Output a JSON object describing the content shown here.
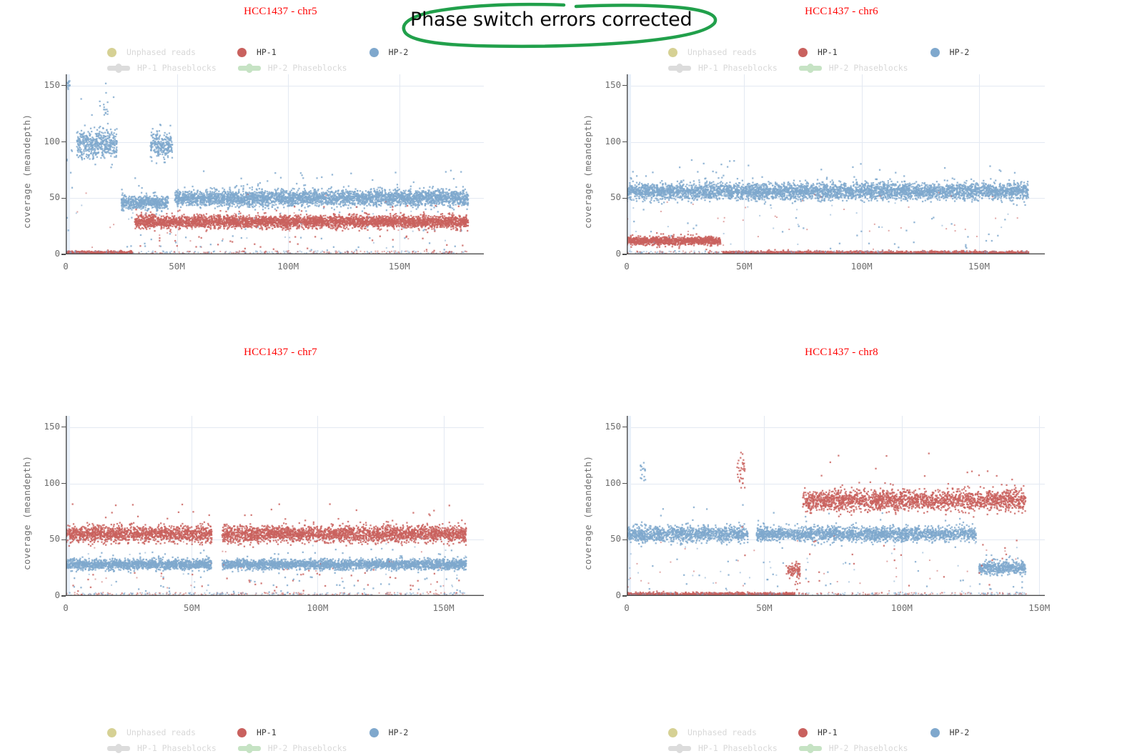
{
  "annotation": {
    "text": "Phase switch errors corrected",
    "stroke_color": "#21a04b",
    "shape": "hand-drawn-ellipse"
  },
  "colors": {
    "hp1": "#c9615e",
    "hp2": "#7fa8cd",
    "unphased": "#d6d194",
    "hp1_phaseblock": "#dcdcdc",
    "hp2_phaseblock": "#c6e3c4",
    "title": "#ff0000",
    "axis": "#4d4d4d",
    "grid": "#e3e9f2",
    "tick_text": "#6e6e6e",
    "legend_strong": "#3a3a3a",
    "legend_faint": "#d8d8d8",
    "chrom_band": "#e8f0fa"
  },
  "legend": {
    "unphased_reads": "Unphased reads",
    "hp1": "HP-1",
    "hp2": "HP-2",
    "hp1_phaseblocks": "HP-1 Phaseblocks",
    "hp2_phaseblocks": "HP-2 Phaseblocks"
  },
  "axis": {
    "ylabel": "coverage (meandepth)",
    "yticks": [
      "0",
      "50",
      "100",
      "150"
    ],
    "ytick_values": [
      0,
      50,
      100,
      150
    ],
    "ylim": [
      0,
      160
    ]
  },
  "panels": [
    {
      "id": "chr5",
      "title": "HCC1437 - chr5",
      "xticks": [
        "0",
        "50M",
        "100M",
        "150M"
      ],
      "xtick_values": [
        0,
        50,
        100,
        150
      ],
      "xlim": [
        0,
        188
      ]
    },
    {
      "id": "chr6",
      "title": "HCC1437 - chr6",
      "xticks": [
        "0",
        "50M",
        "100M",
        "150M"
      ],
      "xtick_values": [
        0,
        50,
        100,
        150
      ],
      "xlim": [
        0,
        178
      ]
    },
    {
      "id": "chr7",
      "title": "HCC1437 - chr7",
      "xticks": [
        "0",
        "50M",
        "100M",
        "150M"
      ],
      "xtick_values": [
        0,
        50,
        100,
        150
      ],
      "xlim": [
        0,
        166
      ]
    },
    {
      "id": "chr8",
      "title": "HCC1437 - chr8",
      "xticks": [
        "0",
        "50M",
        "100M",
        "150M"
      ],
      "xtick_values": [
        0,
        50,
        100,
        150
      ],
      "xlim": [
        0,
        152
      ]
    }
  ],
  "chart_data": [
    {
      "type": "scatter",
      "id": "chr5",
      "title": "HCC1437 - chr5",
      "xlabel": "",
      "ylabel": "coverage (meandepth)",
      "xlim": [
        0,
        188
      ],
      "ylim": [
        0,
        160
      ],
      "xtick_labels": [
        "0",
        "50M",
        "100M",
        "150M"
      ],
      "ytick_labels": [
        "0",
        "50",
        "100",
        "150"
      ],
      "grid": true,
      "legend": [
        "Unphased reads",
        "HP-1",
        "HP-2",
        "HP-1 Phaseblocks",
        "HP-2 Phaseblocks"
      ],
      "series": [
        {
          "name": "HP-2",
          "color": "#7fa8cd",
          "segments": [
            {
              "x_start": 0,
              "x_end": 2,
              "level": 150,
              "spread": 4,
              "density": 0.3,
              "note": "clipped top edge"
            },
            {
              "x_start": 0,
              "x_end": 3,
              "level": 75,
              "spread": 60,
              "density": 0.1,
              "note": "telomere scatter"
            },
            {
              "x_start": 5,
              "x_end": 23,
              "level": 98,
              "spread": 14,
              "density": 1.0
            },
            {
              "x_start": 17,
              "x_end": 19,
              "level": 130,
              "spread": 22,
              "density": 0.25
            },
            {
              "x_start": 25,
              "x_end": 46,
              "level": 46,
              "spread": 7,
              "density": 1.0
            },
            {
              "x_start": 38,
              "x_end": 48,
              "level": 97,
              "spread": 13,
              "density": 0.95
            },
            {
              "x_start": 49,
              "x_end": 181,
              "level": 50,
              "spread": 8,
              "density": 1.0
            }
          ]
        },
        {
          "name": "HP-1",
          "color": "#c9615e",
          "segments": [
            {
              "x_start": 0,
              "x_end": 30,
              "level": 1,
              "spread": 2,
              "density": 0.95
            },
            {
              "x_start": 31,
              "x_end": 181,
              "level": 29,
              "spread": 6,
              "density": 1.0
            }
          ]
        }
      ]
    },
    {
      "type": "scatter",
      "id": "chr6",
      "title": "HCC1437 - chr6",
      "xlabel": "",
      "ylabel": "coverage (meandepth)",
      "xlim": [
        0,
        178
      ],
      "ylim": [
        0,
        160
      ],
      "xtick_labels": [
        "0",
        "50M",
        "100M",
        "150M"
      ],
      "ytick_labels": [
        "0",
        "50",
        "100",
        "150"
      ],
      "grid": true,
      "legend": [
        "Unphased reads",
        "HP-1",
        "HP-2",
        "HP-1 Phaseblocks",
        "HP-2 Phaseblocks"
      ],
      "series": [
        {
          "name": "HP-2",
          "color": "#7fa8cd",
          "segments": [
            {
              "x_start": 0,
              "x_end": 171,
              "level": 56,
              "spread": 8,
              "density": 1.0
            }
          ]
        },
        {
          "name": "HP-1",
          "color": "#c9615e",
          "segments": [
            {
              "x_start": 0,
              "x_end": 40,
              "level": 12,
              "spread": 4,
              "density": 1.0
            },
            {
              "x_start": 41,
              "x_end": 171,
              "level": 1,
              "spread": 2,
              "density": 0.8
            }
          ]
        }
      ]
    },
    {
      "type": "scatter",
      "id": "chr7",
      "title": "HCC1437 - chr7",
      "xlabel": "",
      "ylabel": "coverage (meandepth)",
      "xlim": [
        0,
        166
      ],
      "ylim": [
        0,
        160
      ],
      "xtick_labels": [
        "0",
        "50M",
        "100M",
        "150M"
      ],
      "ytick_labels": [
        "0",
        "50",
        "100",
        "150"
      ],
      "grid": true,
      "legend": [
        "Unphased reads",
        "HP-1",
        "HP-2",
        "HP-1 Phaseblocks",
        "HP-2 Phaseblocks"
      ],
      "series": [
        {
          "name": "HP-1",
          "color": "#c9615e",
          "segments": [
            {
              "x_start": 0,
              "x_end": 58,
              "level": 55,
              "spread": 8,
              "density": 1.0
            },
            {
              "x_start": 62,
              "x_end": 159,
              "level": 55,
              "spread": 8,
              "density": 1.0
            }
          ]
        },
        {
          "name": "HP-2",
          "color": "#7fa8cd",
          "segments": [
            {
              "x_start": 0,
              "x_end": 58,
              "level": 28,
              "spread": 5,
              "density": 1.0
            },
            {
              "x_start": 62,
              "x_end": 159,
              "level": 28,
              "spread": 5,
              "density": 1.0
            }
          ]
        }
      ],
      "annotations": [
        {
          "type": "centromere-gap",
          "x_start": 58,
          "x_end": 62
        }
      ]
    },
    {
      "type": "scatter",
      "id": "chr8",
      "title": "HCC1437 - chr8",
      "xlabel": "",
      "ylabel": "coverage (meandepth)",
      "xlim": [
        0,
        152
      ],
      "ylim": [
        0,
        160
      ],
      "xtick_labels": [
        "0",
        "50M",
        "100M",
        "150M"
      ],
      "ytick_labels": [
        "0",
        "50",
        "100",
        "150"
      ],
      "grid": true,
      "legend": [
        "Unphased reads",
        "HP-1",
        "HP-2",
        "HP-1 Phaseblocks",
        "HP-2 Phaseblocks"
      ],
      "series": [
        {
          "name": "HP-2",
          "color": "#7fa8cd",
          "segments": [
            {
              "x_start": 0,
              "x_end": 44,
              "level": 55,
              "spread": 8,
              "density": 1.0
            },
            {
              "x_start": 5,
              "x_end": 7,
              "level": 112,
              "spread": 12,
              "density": 0.3
            },
            {
              "x_start": 47,
              "x_end": 127,
              "level": 55,
              "spread": 7,
              "density": 1.0
            },
            {
              "x_start": 128,
              "x_end": 145,
              "level": 25,
              "spread": 6,
              "density": 1.0
            }
          ]
        },
        {
          "name": "HP-1",
          "color": "#c9615e",
          "segments": [
            {
              "x_start": 0,
              "x_end": 61,
              "level": 1,
              "spread": 2,
              "density": 0.95
            },
            {
              "x_start": 40,
              "x_end": 43,
              "level": 112,
              "spread": 18,
              "density": 0.45
            },
            {
              "x_start": 58,
              "x_end": 63,
              "level": 22,
              "spread": 8,
              "density": 0.7
            },
            {
              "x_start": 64,
              "x_end": 145,
              "level": 85,
              "spread": 10,
              "density": 1.0
            }
          ]
        }
      ]
    }
  ]
}
